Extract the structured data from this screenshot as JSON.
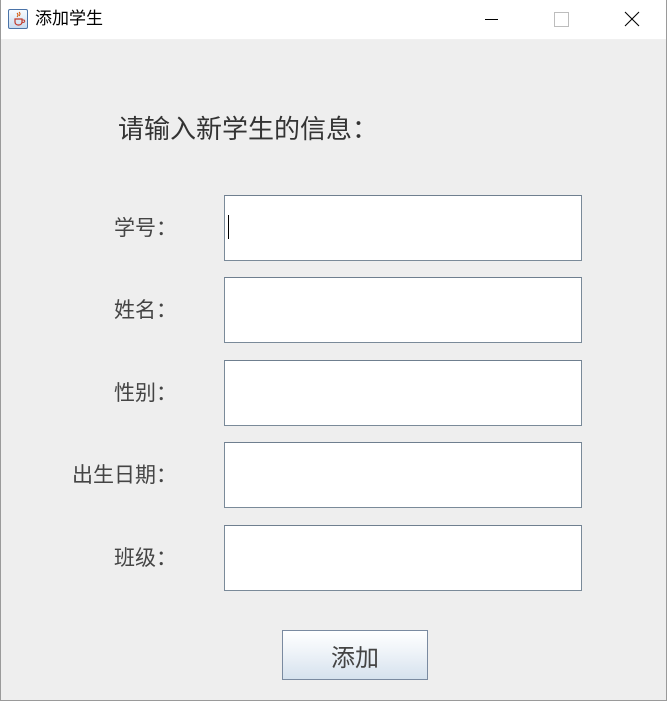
{
  "window": {
    "title": "添加学生",
    "app_icon": "java-icon",
    "controls": [
      "minimize-icon",
      "maximize-icon",
      "close-icon"
    ]
  },
  "form": {
    "heading": "请输入新学生的信息：",
    "fields": [
      {
        "label": "学号：",
        "value": "",
        "focused": true
      },
      {
        "label": "姓名：",
        "value": ""
      },
      {
        "label": "性别：",
        "value": ""
      },
      {
        "label": "出生日期：",
        "value": ""
      },
      {
        "label": "班级：",
        "value": ""
      }
    ],
    "submit_label": "添加"
  },
  "colors": {
    "window_background": "#eeeeee",
    "titlebar_background": "#ffffff",
    "input_border": "#7a8a99",
    "text": "#444444"
  }
}
